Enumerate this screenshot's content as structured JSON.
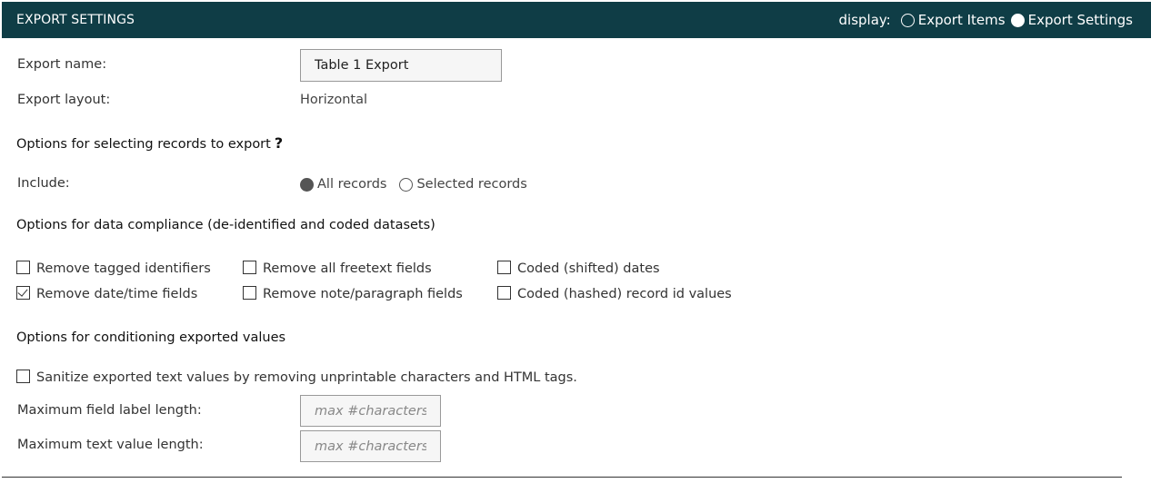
{
  "header": {
    "title": "EXPORT SETTINGS",
    "display_label": "display:",
    "display_options": [
      {
        "label": "Export Items",
        "selected": false
      },
      {
        "label": "Export Settings",
        "selected": true
      }
    ]
  },
  "export_name": {
    "label": "Export name:",
    "value": "Table 1 Export"
  },
  "export_layout": {
    "label": "Export layout:",
    "value": "Horizontal"
  },
  "selecting": {
    "heading": "Options for selecting records to export",
    "help_icon": "?",
    "include_label": "Include:",
    "options": [
      {
        "label": "All records",
        "selected": true
      },
      {
        "label": "Selected records",
        "selected": false
      }
    ]
  },
  "compliance": {
    "heading": "Options for data compliance (de-identified and coded datasets)",
    "checkboxes": [
      {
        "label": "Remove tagged identifiers",
        "checked": false
      },
      {
        "label": "Remove all freetext fields",
        "checked": false
      },
      {
        "label": "Coded (shifted) dates",
        "checked": false
      },
      {
        "label": "Remove date/time fields",
        "checked": true
      },
      {
        "label": "Remove note/paragraph fields",
        "checked": false
      },
      {
        "label": "Coded (hashed) record id values",
        "checked": false
      }
    ]
  },
  "conditioning": {
    "heading": "Options for conditioning exported values",
    "sanitize": {
      "label": "Sanitize exported text values by removing unprintable characters and HTML tags.",
      "checked": false
    },
    "max_label": {
      "label": "Maximum field label length:",
      "placeholder": "max #characters"
    },
    "max_text": {
      "label": "Maximum text value length:",
      "placeholder": "max #characters"
    }
  }
}
